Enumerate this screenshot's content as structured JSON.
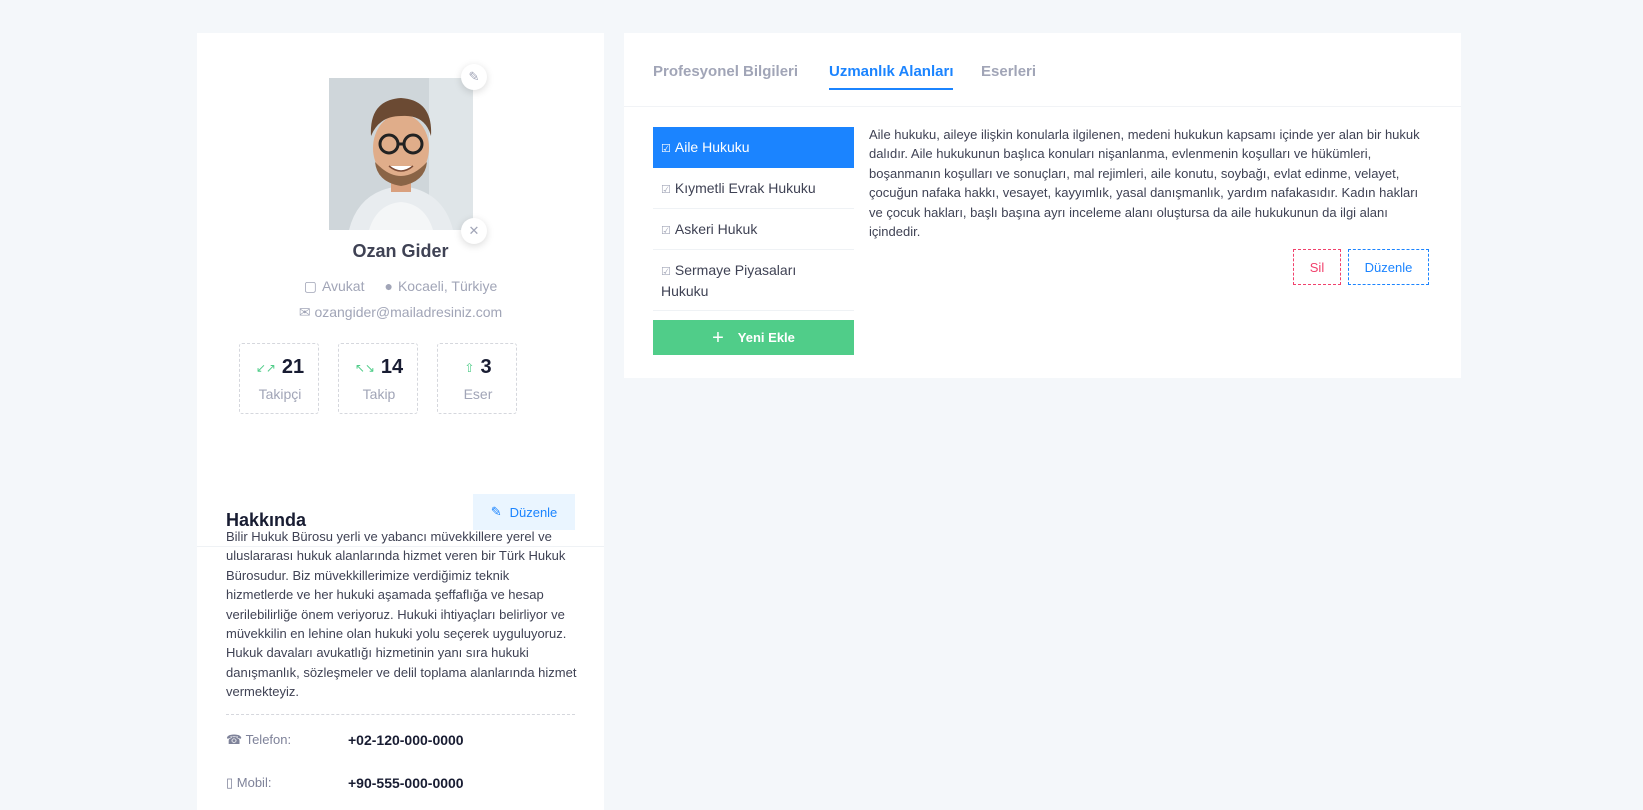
{
  "profile": {
    "name": "Ozan Gider",
    "title": "Avukat",
    "location": "Kocaeli, Türkiye",
    "email": "ozangider@mailadresiniz.com",
    "stats": [
      {
        "value": "21",
        "label": "Takipçi",
        "icon": "arrows-in-icon"
      },
      {
        "value": "14",
        "label": "Takip",
        "icon": "arrows-out-icon"
      },
      {
        "value": "3",
        "label": "Eser",
        "icon": "file-up-icon"
      }
    ]
  },
  "about": {
    "title": "Hakkında",
    "edit_label": "Düzenle",
    "text": "Bilir Hukuk Bürosu yerli ve yabancı müvekkillere yerel ve uluslararası hukuk alanlarında hizmet veren bir Türk Hukuk Bürosudur. Biz müvekkillerimize verdiğimiz teknik hizmetlerde ve her hukuki aşamada şeffaflığa ve hesap verilebilirliğe önem veriyoruz. Hukuki ihtiyaçları belirliyor ve müvekkilin en lehine olan hukuki yolu seçerek uyguluyoruz. Hukuk davaları avukatlığı hizmetinin yanı sıra hukuki danışmanlık, sözleşmeler ve delil toplama alanlarında hizmet vermekteyiz.",
    "phone_label": "Telefon:",
    "phone": "+02-120-000-0000",
    "mobile_label": "Mobil:",
    "mobile": "+90-555-000-0000"
  },
  "tabs": [
    "Profesyonel Bilgileri",
    "Uzmanlık Alanları",
    "Eserleri"
  ],
  "active_tab": "Uzmanlık Alanları",
  "categories": [
    "Aile Hukuku",
    "Kıymetli Evrak Hukuku",
    "Askeri Hukuk",
    "Sermaye Piyasaları Hukuku"
  ],
  "add_label": "Yeni Ekle",
  "description": "Aile hukuku, aileye ilişkin konularla ilgilenen, medeni hukukun kapsamı içinde yer alan bir hukuk dalıdır. Aile hukukunun başlıca konuları nişanlanma, evlenmenin koşulları ve hükümleri, boşanmanın koşulları ve sonuçları, mal rejimleri, aile konutu, soybağı, evlat edinme, velayet, çocuğun nafaka hakkı, vesayet, kayyımlık, yasal danışmanlık, yardım nafakasıdır. Kadın hakları ve çocuk hakları, başlı başına ayrı inceleme alanı oluştursa da aile hukukunun da ilgi alanı içindedir.",
  "delete_label": "Sil",
  "edit_label": "Düzenle",
  "colors": {
    "primary": "#1b84ff",
    "success": "#50cd89",
    "danger": "#f1416c"
  }
}
